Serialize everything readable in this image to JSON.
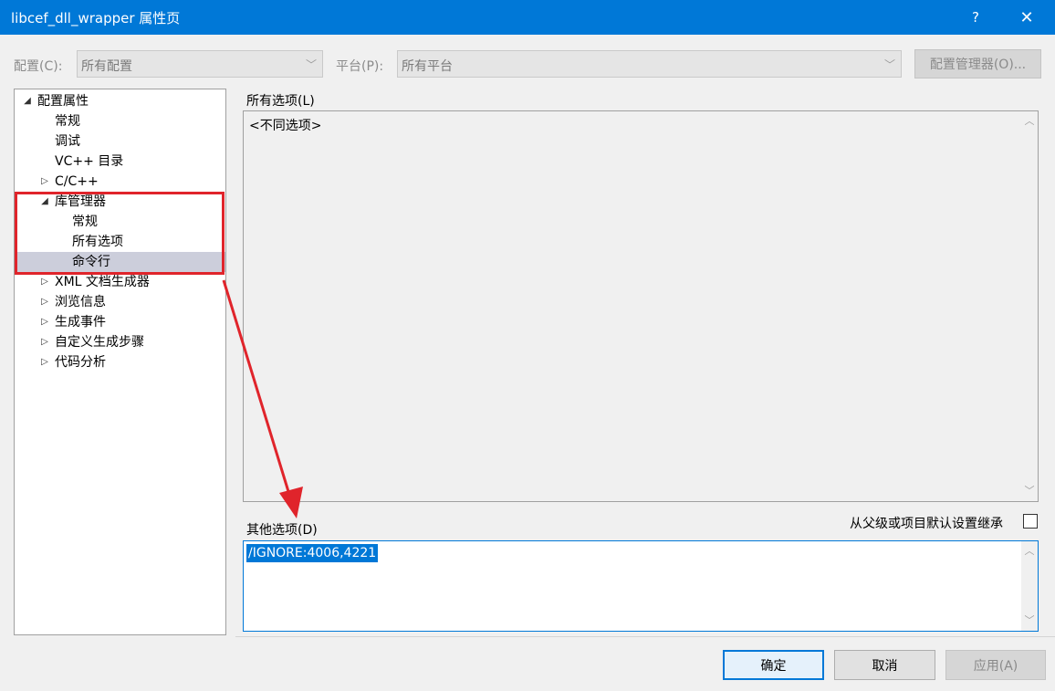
{
  "window": {
    "title": "libcef_dll_wrapper 属性页",
    "help_label": "?",
    "close_label": "✕"
  },
  "config": {
    "config_label": "配置(C):",
    "config_value": "所有配置",
    "platform_label": "平台(P):",
    "platform_value": "所有平台",
    "manager_button": "配置管理器(O)..."
  },
  "tree": {
    "items": [
      {
        "label": "配置属性",
        "expander": "◢",
        "level": 0
      },
      {
        "label": "常规",
        "expander": "",
        "level": 1
      },
      {
        "label": "调试",
        "expander": "",
        "level": 1
      },
      {
        "label": "VC++ 目录",
        "expander": "",
        "level": 1
      },
      {
        "label": "C/C++",
        "expander": "▷",
        "level": 1
      },
      {
        "label": "库管理器",
        "expander": "◢",
        "level": 1
      },
      {
        "label": "常规",
        "expander": "",
        "level": 2
      },
      {
        "label": "所有选项",
        "expander": "",
        "level": 2
      },
      {
        "label": "命令行",
        "expander": "",
        "level": 2,
        "selected": true
      },
      {
        "label": "XML 文档生成器",
        "expander": "▷",
        "level": 1
      },
      {
        "label": "浏览信息",
        "expander": "▷",
        "level": 1
      },
      {
        "label": "生成事件",
        "expander": "▷",
        "level": 1
      },
      {
        "label": "自定义生成步骤",
        "expander": "▷",
        "level": 1
      },
      {
        "label": "代码分析",
        "expander": "▷",
        "level": 1
      }
    ]
  },
  "all_options": {
    "label": "所有选项(L)",
    "value": "<不同选项>"
  },
  "other_options": {
    "label": "其他选项(D)",
    "value": "/IGNORE:4006,4221",
    "inherit_label": "从父级或项目默认设置继承",
    "inherit_checked": false
  },
  "buttons": {
    "ok": "确定",
    "cancel": "取消",
    "apply": "应用(A)"
  },
  "icons": {
    "scroll_up": "︿",
    "scroll_down": "﹀",
    "combo_arrow": "﹀"
  },
  "colors": {
    "titlebar": "#0078d7",
    "highlight": "#e0242b",
    "selection": "#cccedb"
  }
}
